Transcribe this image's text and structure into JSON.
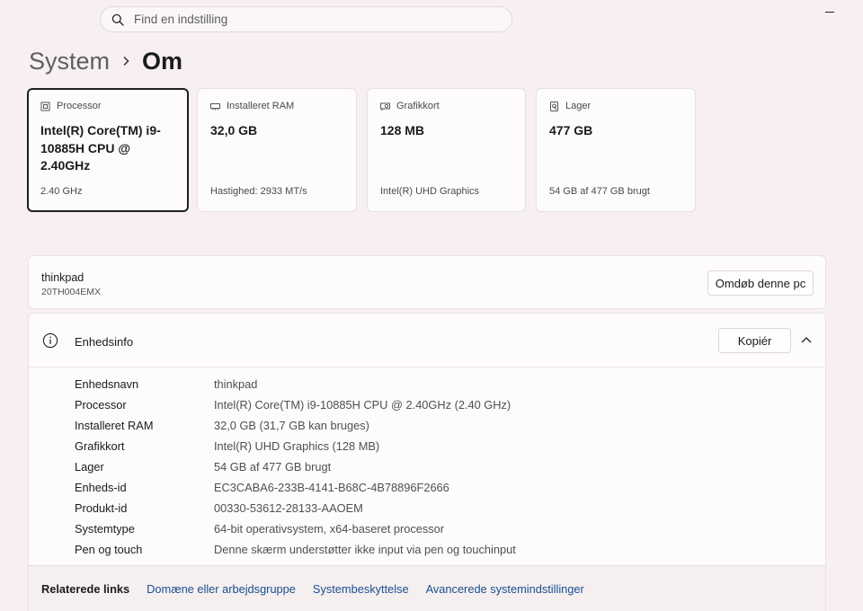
{
  "search": {
    "placeholder": "Find en indstilling"
  },
  "breadcrumb": {
    "parent": "System",
    "current": "Om"
  },
  "cards": [
    {
      "icon": "processor-icon",
      "label": "Processor",
      "value": "Intel(R) Core(TM) i9-10885H CPU @ 2.40GHz",
      "sub": "2.40 GHz"
    },
    {
      "icon": "ram-icon",
      "label": "Installeret RAM",
      "value": "32,0 GB",
      "sub": "Hastighed: 2933 MT/s"
    },
    {
      "icon": "graphics-card-icon",
      "label": "Grafikkort",
      "value": "128 MB",
      "sub": "Intel(R) UHD Graphics"
    },
    {
      "icon": "storage-icon",
      "label": "Lager",
      "value": "477 GB",
      "sub": "54 GB af 477 GB brugt"
    }
  ],
  "pc": {
    "name": "thinkpad",
    "model": "20TH004EMX",
    "rename_label": "Omdøb denne pc"
  },
  "device_info": {
    "title": "Enhedsinfo",
    "copy_label": "Kopiér",
    "rows": [
      {
        "label": "Enhedsnavn",
        "value": "thinkpad"
      },
      {
        "label": "Processor",
        "value": "Intel(R) Core(TM) i9-10885H CPU @ 2.40GHz (2.40 GHz)"
      },
      {
        "label": "Installeret RAM",
        "value": "32,0 GB (31,7 GB kan bruges)"
      },
      {
        "label": "Grafikkort",
        "value": "Intel(R) UHD Graphics (128 MB)"
      },
      {
        "label": "Lager",
        "value": "54 GB af 477 GB brugt"
      },
      {
        "label": "Enheds-id",
        "value": "EC3CABA6-233B-4141-B68C-4B78896F2666"
      },
      {
        "label": "Produkt-id",
        "value": "00330-53612-28133-AAOEM"
      },
      {
        "label": "Systemtype",
        "value": "64-bit operativsystem, x64-baseret processor"
      },
      {
        "label": "Pen og touch",
        "value": "Denne skærm understøtter ikke input via pen og touchinput"
      }
    ]
  },
  "related": {
    "label": "Relaterede links",
    "links": [
      "Domæne eller arbejdsgruppe",
      "Systembeskyttelse",
      "Avancerede systemindstillinger"
    ]
  },
  "colors": {
    "accent_link": "#1a4f91",
    "background": "#f7eff0"
  }
}
